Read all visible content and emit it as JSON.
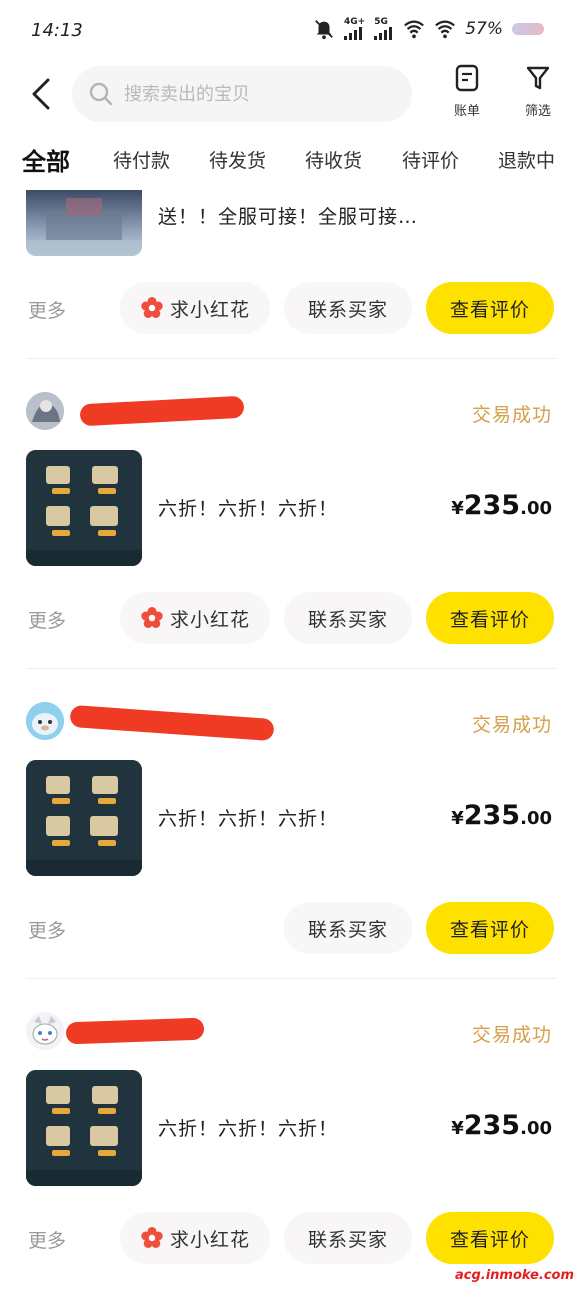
{
  "status_bar": {
    "time": "14:13",
    "net_4g": "4G+",
    "net_5g": "5G",
    "battery": "57%"
  },
  "header": {
    "search_placeholder": "搜索卖出的宝贝",
    "bill_label": "账单",
    "filter_label": "筛选"
  },
  "tabs": [
    "全部",
    "待付款",
    "待发货",
    "待收货",
    "待评价",
    "退款中"
  ],
  "partial_item": {
    "title": "送！！全服可接！全服可接…"
  },
  "orders": [
    {
      "status": "交易成功",
      "title": "六折！六折！六折！",
      "price_symbol": "¥",
      "price_int": "235",
      "price_dec": ".00"
    },
    {
      "status": "交易成功",
      "title": "六折！六折！六折！",
      "price_symbol": "¥",
      "price_int": "235",
      "price_dec": ".00"
    },
    {
      "status": "交易成功",
      "title": "六折！六折！六折！",
      "price_symbol": "¥",
      "price_int": "235",
      "price_dec": ".00"
    }
  ],
  "actions": {
    "more": "更多",
    "flower": "求小红花",
    "contact": "联系买家",
    "review": "查看评价"
  },
  "colors": {
    "accent": "#ffe100",
    "status": "#d4a04a",
    "flower": "#ee4e3c"
  },
  "watermark": "acg.inmoke.com"
}
